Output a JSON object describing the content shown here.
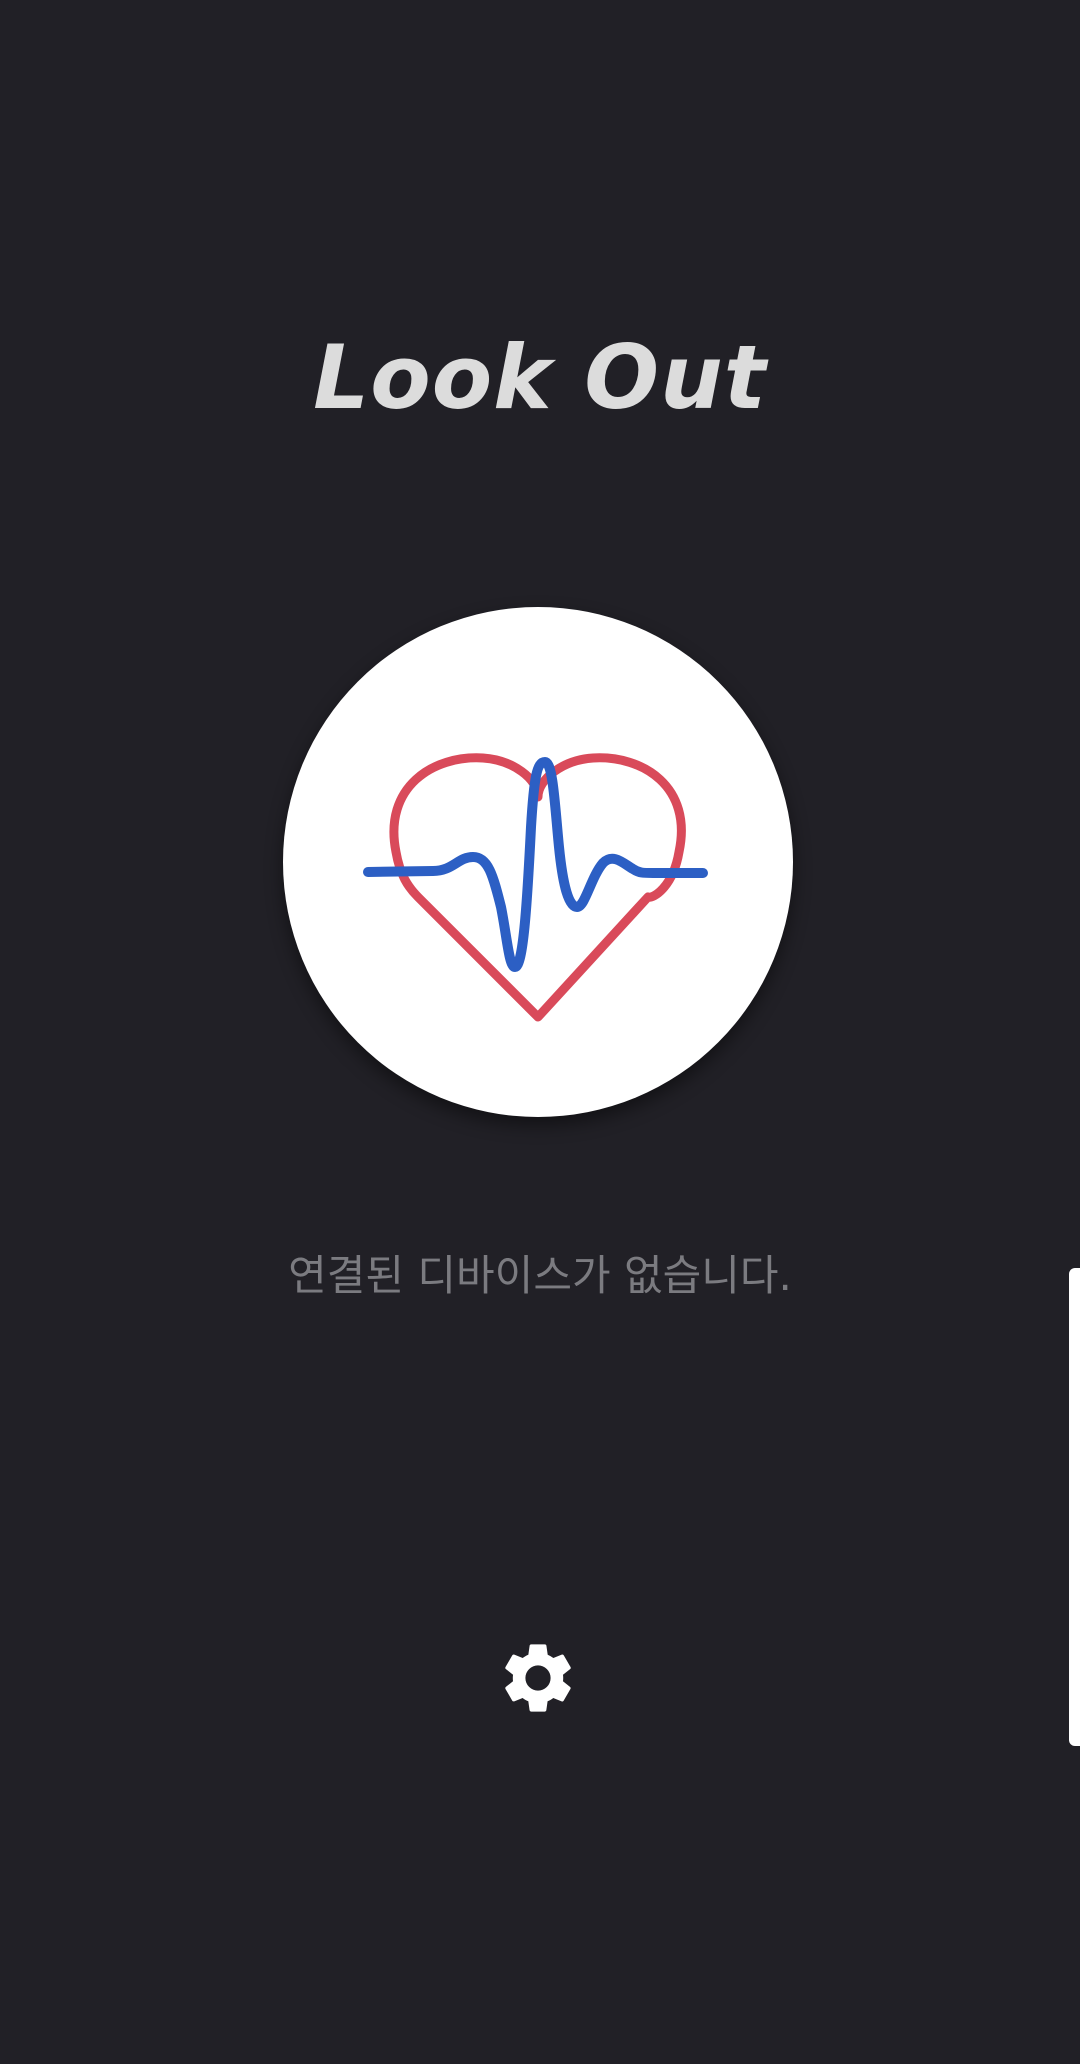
{
  "app": {
    "title": "Look Out"
  },
  "monitor_button": {
    "icon": "heart-pulse-icon"
  },
  "status": {
    "message": "연결된 디바이스가 없습니다."
  },
  "settings": {
    "icon": "gear-icon"
  },
  "edge_panel": {
    "icon": "edge-panel-handle"
  },
  "colors": {
    "background": "#212026",
    "title": "#dcdcdc",
    "status_text": "#7b7b80",
    "heart_outline": "#d94a5a",
    "pulse_line": "#2c5fc4"
  }
}
